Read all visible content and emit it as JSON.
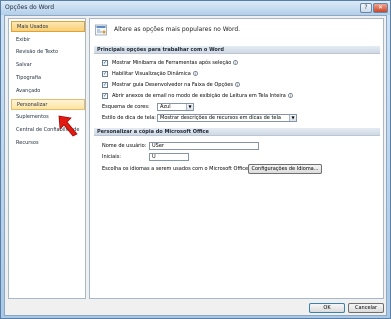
{
  "window": {
    "title": "Opções do Word",
    "help_glyph": "?",
    "close_glyph": "✕"
  },
  "sidebar": {
    "items": [
      {
        "label": "Mais Usados"
      },
      {
        "label": "Exibir"
      },
      {
        "label": "Revisão de Texto"
      },
      {
        "label": "Salvar"
      },
      {
        "label": "Tipografia"
      },
      {
        "label": "Avançado"
      },
      {
        "label": "Personalizar"
      },
      {
        "label": "Suplementos"
      },
      {
        "label": "Central de Confiabilidade"
      },
      {
        "label": "Recursos"
      }
    ],
    "selected_index": 0,
    "hover_index": 6
  },
  "main": {
    "header_text": "Altere as opções mais populares no Word.",
    "section1": {
      "title": "Principais opções para trabalhar com o Word",
      "options": [
        {
          "label": "Mostrar Minibarra de Ferramentas após seleção",
          "checked": true
        },
        {
          "label": "Habilitar Visualização Dinâmica",
          "checked": true
        },
        {
          "label": "Mostrar guia Desenvolvedor na Faixa de Opções",
          "checked": true
        },
        {
          "label": "Abrir anexos de email no modo de exibição de Leitura em Tela Inteira",
          "checked": true
        }
      ],
      "color_scheme_label": "Esquema de cores:",
      "color_scheme_value": "Azul",
      "tooltip_label": "Estilo de dica de tela:",
      "tooltip_value": "Mostrar descrições de recursos em dicas de tela",
      "check_glyph": "✓",
      "info_glyph": "i",
      "dropdown_glyph": "▼"
    },
    "section2": {
      "title": "Personalizar a cópia do Microsoft Office",
      "username_label": "Nome de usuário:",
      "username_value": "USer",
      "initials_label": "Iniciais:",
      "initials_value": "U",
      "language_label": "Escolha os idiomas a serem usados com o Microsoft Office:",
      "language_button": "Configurações de Idioma..."
    }
  },
  "footer": {
    "ok": "OK",
    "cancel": "Cancelar"
  }
}
